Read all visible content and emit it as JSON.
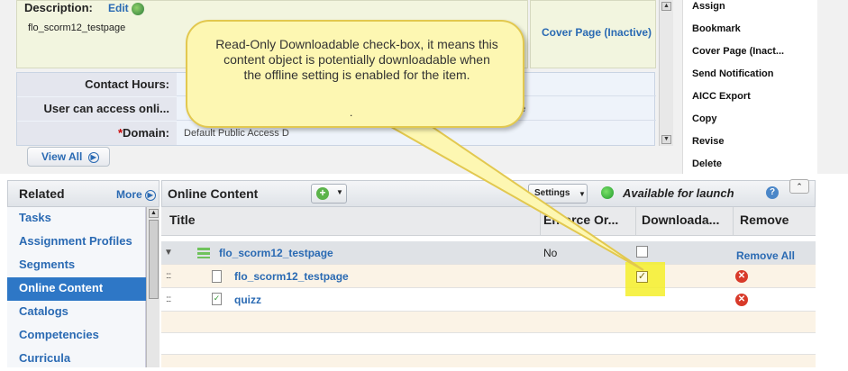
{
  "description": {
    "label": "Description:",
    "edit": "Edit",
    "value": "flo_scorm12_testpage"
  },
  "cover_page_inactive": "Cover Page (Inactive)",
  "properties": [
    {
      "label": "Contact Hours:",
      "value": ""
    },
    {
      "label": "User can access onli...",
      "value": "ne"
    },
    {
      "label": "Domain:",
      "required": "*",
      "value": "Default Public Access D"
    }
  ],
  "view_all": "View All",
  "actions": [
    "Assign",
    "Bookmark",
    "Cover Page (Inact...",
    "Send Notification",
    "AICC Export",
    "Copy",
    "Revise",
    "Delete"
  ],
  "related": {
    "title": "Related",
    "more": "More",
    "items": [
      "Tasks",
      "Assignment Profiles",
      "Segments",
      "Online Content",
      "Catalogs",
      "Competencies",
      "Curricula"
    ],
    "active_index": 3
  },
  "online_content": {
    "title": "Online Content",
    "settings": "Settings",
    "status": "Available for launch",
    "columns": {
      "title": "Title",
      "enforce": "Enforce Or...",
      "download": "Downloada...",
      "remove": "Remove"
    },
    "group": {
      "name": "flo_scorm12_testpage",
      "enforce": "No",
      "download_checked": false,
      "remove": "Remove All"
    },
    "rows": [
      {
        "name": "flo_scorm12_testpage",
        "download_checked": true
      },
      {
        "name": "quizz",
        "download_checked": false
      }
    ]
  },
  "callout": "Read-Only Downloadable check-box, it means this content object is potentially downloadable when the offline setting is enabled for the item.",
  "callout_extra": ".",
  "colors": {
    "link": "#2a6ab3",
    "active": "#2e77c6",
    "callout": "#fdf7b2",
    "highlight": "#f4ef2a"
  }
}
